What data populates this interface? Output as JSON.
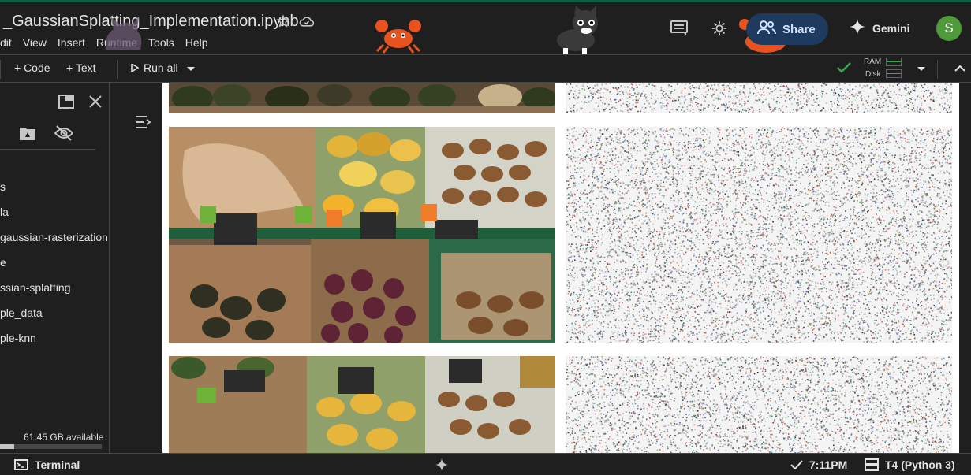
{
  "notebook": {
    "title": "_GaussianSplatting_Implementation.ipynb"
  },
  "menu": [
    "dit",
    "View",
    "Insert",
    "Runtime",
    "Tools",
    "Help"
  ],
  "header": {
    "share_label": "Share",
    "gemini_label": "Gemini",
    "avatar_letter": "S",
    "icons": [
      "star-icon",
      "cloud-icon",
      "comment-icon",
      "settings-icon"
    ]
  },
  "toolbar": {
    "code_label": "+ Code",
    "text_label": "+ Text",
    "run_all_label": "Run all",
    "ram_label": "RAM",
    "disk_label": "Disk"
  },
  "files": {
    "items": [
      "s",
      "la",
      "gaussian-rasterization",
      "e",
      "ssian-splatting",
      "ple_data",
      "ple-knn"
    ],
    "disk_available": "61.45 GB available",
    "disk_used_fraction": 0.14
  },
  "status": {
    "terminal_label": "Terminal",
    "time": "7:11PM",
    "runtime": "T4 (Python 3)"
  },
  "colors": {
    "accent_green": "#34a853",
    "share_bg": "#1e3a5f",
    "avatar_bg": "#4f9a3a"
  }
}
